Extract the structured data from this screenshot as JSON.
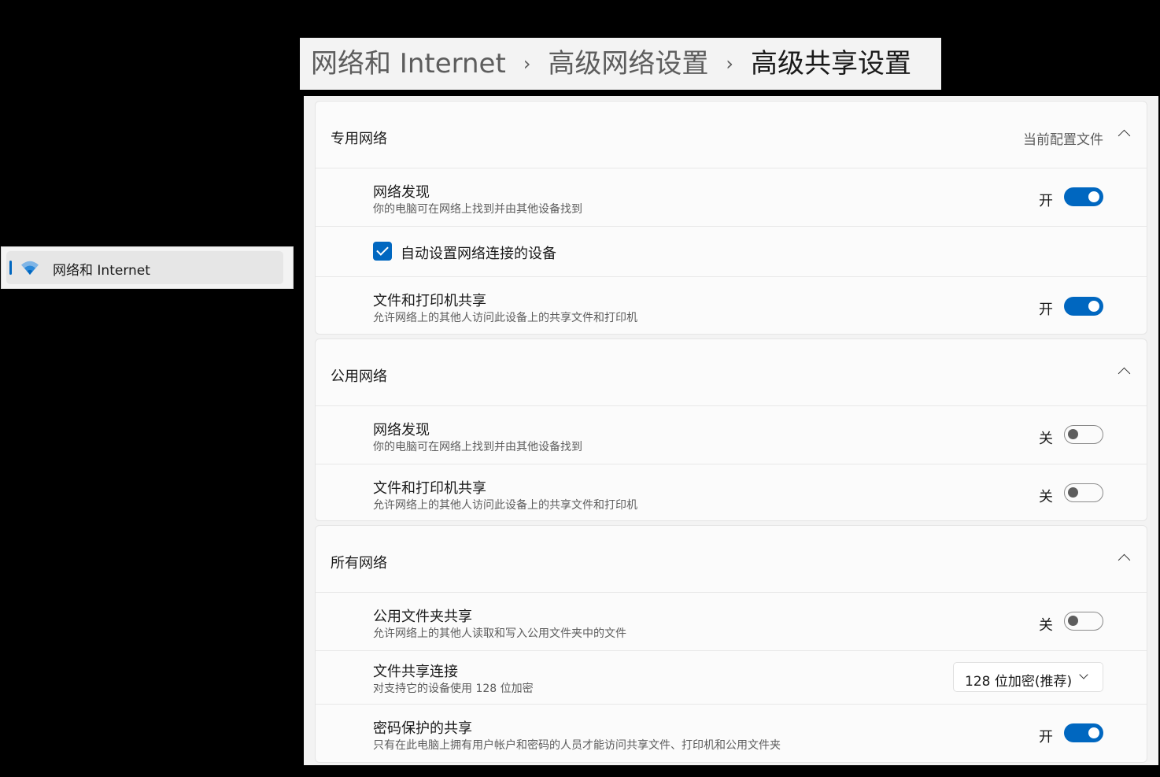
{
  "breadcrumb": {
    "item1": "网络和 Internet",
    "item2": "高级网络设置",
    "item3": "高级共享设置",
    "separator": "›"
  },
  "sidebar": {
    "item_label": "网络和 Internet",
    "item_icon": "wifi-icon"
  },
  "private": {
    "title": "专用网络",
    "profile_label": "当前配置文件",
    "discovery": {
      "title": "网络发现",
      "desc": "你的电脑可在网络上找到并由其他设备找到",
      "state": "开",
      "on": true
    },
    "auto_setup": {
      "label": "自动设置网络连接的设备",
      "checked": true
    },
    "file_print": {
      "title": "文件和打印机共享",
      "desc": "允许网络上的其他人访问此设备上的共享文件和打印机",
      "state": "开",
      "on": true
    }
  },
  "public": {
    "title": "公用网络",
    "discovery": {
      "title": "网络发现",
      "desc": "你的电脑可在网络上找到并由其他设备找到",
      "state": "关",
      "on": false
    },
    "file_print": {
      "title": "文件和打印机共享",
      "desc": "允许网络上的其他人访问此设备上的共享文件和打印机",
      "state": "关",
      "on": false
    }
  },
  "all": {
    "title": "所有网络",
    "public_folder": {
      "title": "公用文件夹共享",
      "desc": "允许网络上的其他人读取和写入公用文件夹中的文件",
      "state": "关",
      "on": false
    },
    "file_sharing": {
      "title": "文件共享连接",
      "desc": "对支持它的设备使用 128 位加密",
      "selected": "128 位加密(推荐)"
    },
    "password": {
      "title": "密码保护的共享",
      "desc": "只有在此电脑上拥有用户帐户和密码的人员才能访问共享文件、打印机和公用文件夹",
      "state": "开",
      "on": true
    }
  },
  "colors": {
    "accent": "#0067c0",
    "background": "#f3f3f3",
    "card": "#fbfbfb"
  }
}
